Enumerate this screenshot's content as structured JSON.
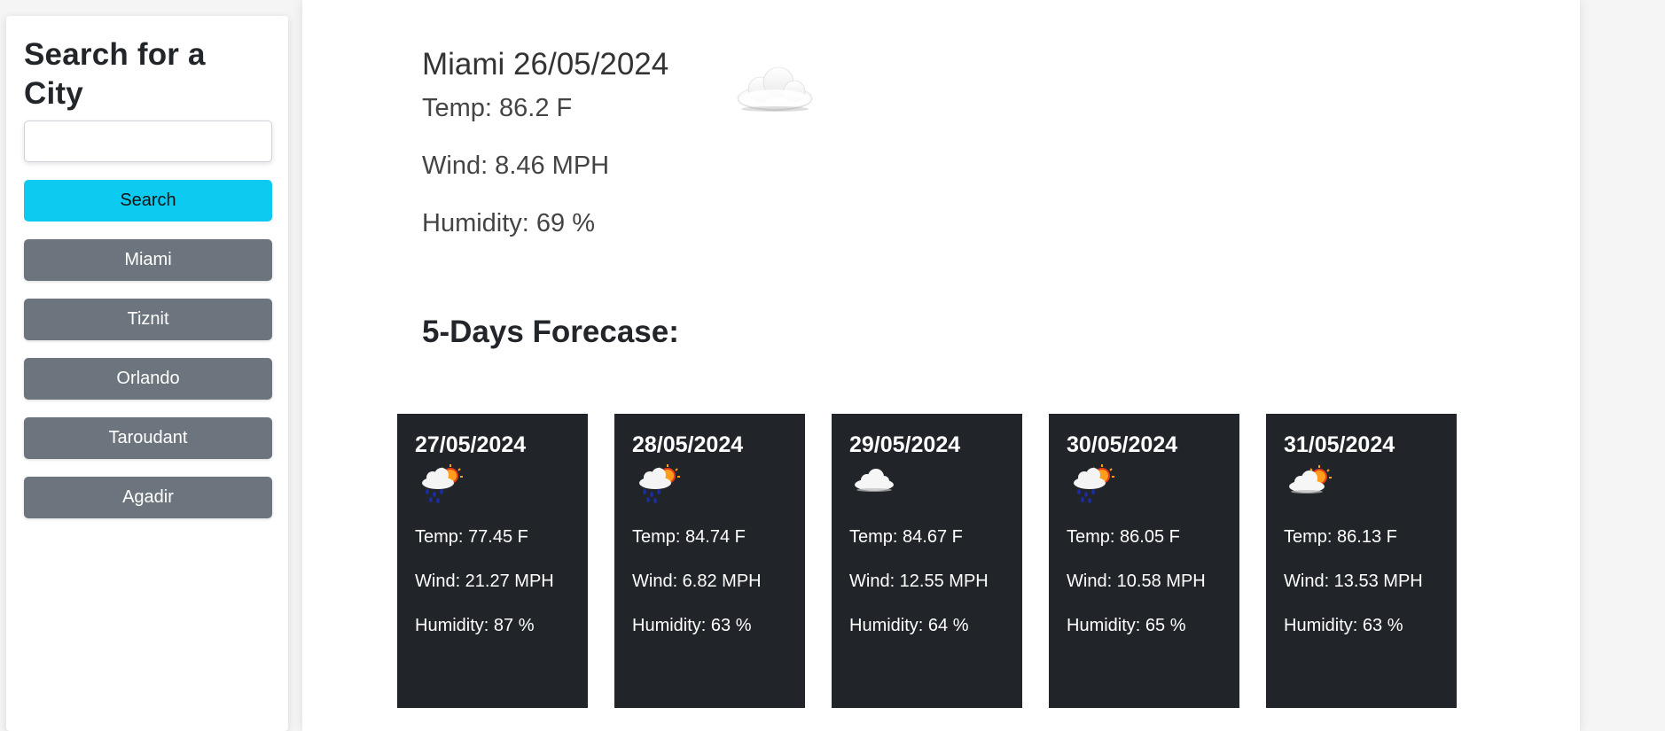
{
  "sidebar": {
    "title": "Search for a City",
    "search_input": {
      "value": "",
      "placeholder": ""
    },
    "search_button": "Search",
    "history": [
      {
        "label": "Miami"
      },
      {
        "label": "Tiznit"
      },
      {
        "label": "Orlando"
      },
      {
        "label": "Taroudant"
      },
      {
        "label": "Agadir"
      }
    ]
  },
  "current": {
    "title": "Miami 26/05/2024",
    "icon": "cloud-icon",
    "temp": "Temp: 86.2 F",
    "wind": "Wind: 8.46 MPH",
    "humidity": "Humidity: 69 %"
  },
  "forecast": {
    "title": "5-Days Forecase:",
    "days": [
      {
        "date": "27/05/2024",
        "icon": "rain-sun-icon",
        "temp": "Temp: 77.45 F",
        "wind": "Wind: 21.27 MPH",
        "humidity": "Humidity: 87 %"
      },
      {
        "date": "28/05/2024",
        "icon": "rain-sun-icon",
        "temp": "Temp: 84.74 F",
        "wind": "Wind: 6.82 MPH",
        "humidity": "Humidity: 63 %"
      },
      {
        "date": "29/05/2024",
        "icon": "cloud-icon",
        "temp": "Temp: 84.67 F",
        "wind": "Wind: 12.55 MPH",
        "humidity": "Humidity: 64 %"
      },
      {
        "date": "30/05/2024",
        "icon": "rain-sun-icon",
        "temp": "Temp: 86.05 F",
        "wind": "Wind: 10.58 MPH",
        "humidity": "Humidity: 65 %"
      },
      {
        "date": "31/05/2024",
        "icon": "sun-cloud-icon",
        "temp": "Temp: 86.13 F",
        "wind": "Wind: 13.53 MPH",
        "humidity": "Humidity: 63 %"
      }
    ]
  },
  "colors": {
    "accent": "#0dcaf0",
    "secondary": "#6c757d",
    "card_bg": "#212529"
  }
}
